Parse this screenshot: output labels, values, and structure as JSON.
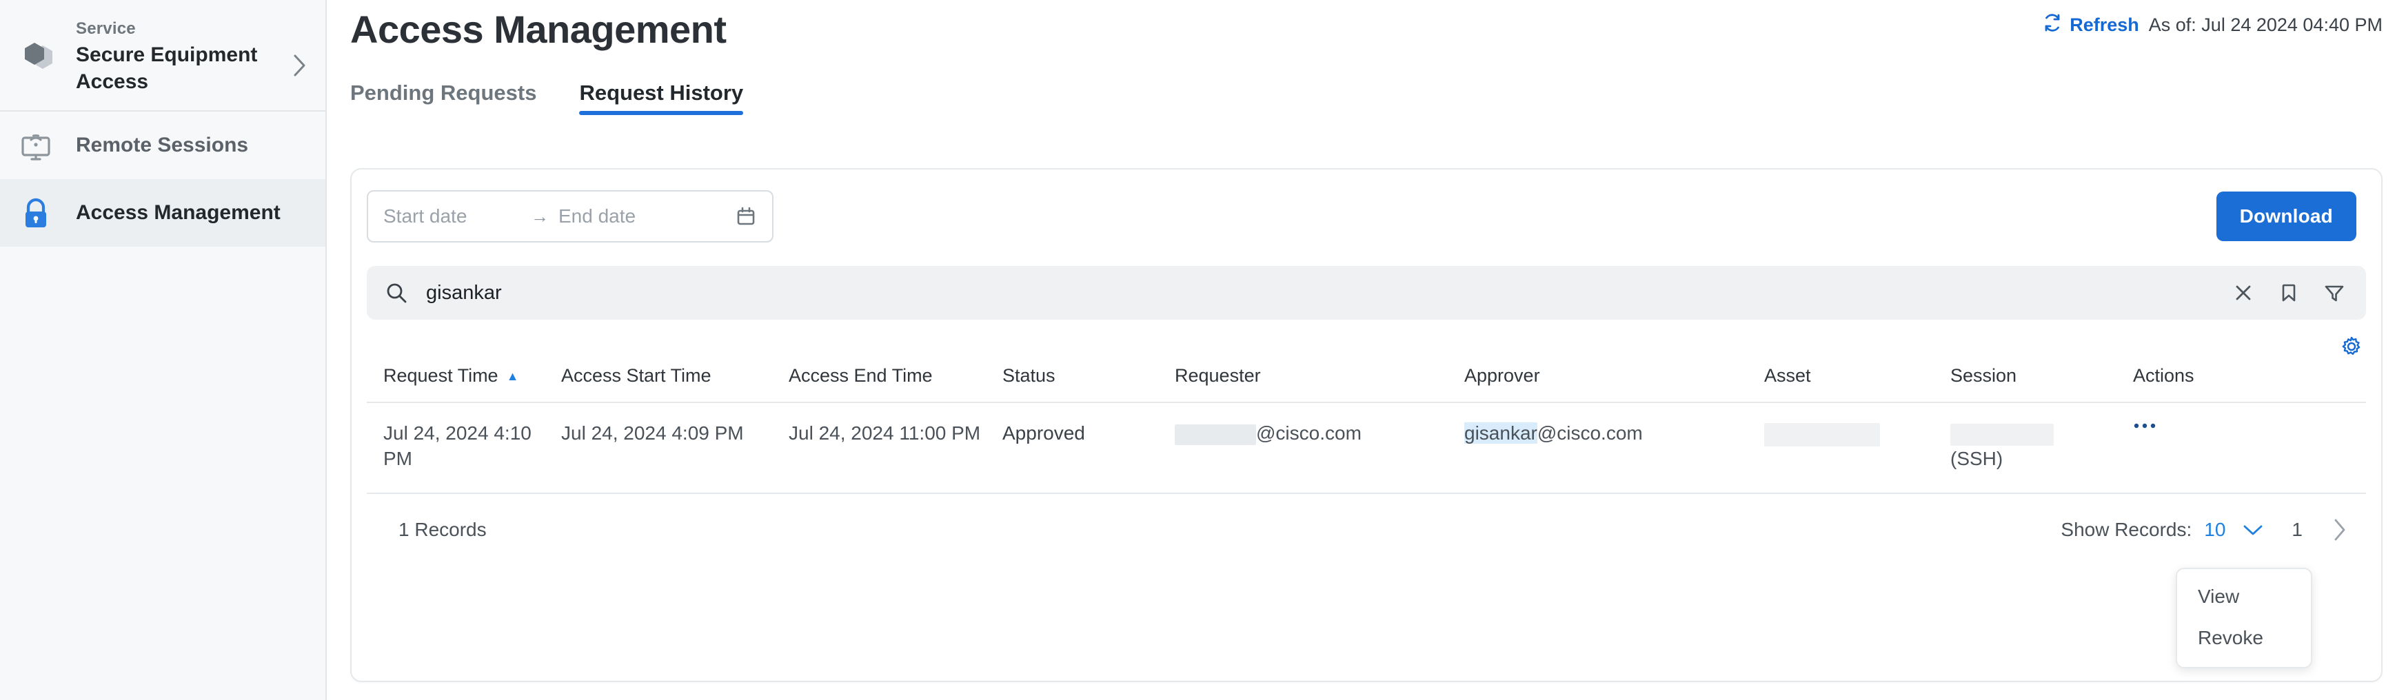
{
  "sidebar": {
    "service": {
      "eyebrow": "Service",
      "name": "Secure Equipment Access",
      "chevron_icon": "chevron-right-icon",
      "logo_icon": "hexagon-logo-icon"
    },
    "items": [
      {
        "label": "Remote Sessions",
        "icon": "remote-monitor-icon",
        "active": false
      },
      {
        "label": "Access Management",
        "icon": "lock-icon",
        "active": true
      }
    ]
  },
  "header": {
    "title": "Access Management",
    "refresh_label": "Refresh",
    "refresh_icon": "refresh-icon",
    "as_of": "As of: Jul 24 2024 04:40 PM"
  },
  "tabs": [
    {
      "label": "Pending Requests",
      "active": false
    },
    {
      "label": "Request History",
      "active": true
    }
  ],
  "filters": {
    "start_date_placeholder": "Start date",
    "range_arrow": "→",
    "end_date_placeholder": "End date",
    "calendar_icon": "calendar-icon",
    "download_label": "Download"
  },
  "search": {
    "icon": "search-icon",
    "value": "gisankar",
    "clear_icon": "close-icon",
    "bookmark_icon": "bookmark-icon",
    "filter_icon": "filter-icon"
  },
  "table": {
    "settings_icon": "gear-icon",
    "columns": [
      {
        "label": "Request Time",
        "sorted": true,
        "sort_icon": "▲"
      },
      {
        "label": "Access Start Time",
        "sorted": false
      },
      {
        "label": "Access End Time",
        "sorted": false
      },
      {
        "label": "Status",
        "sorted": false
      },
      {
        "label": "Requester",
        "sorted": false
      },
      {
        "label": "Approver",
        "sorted": false
      },
      {
        "label": "Asset",
        "sorted": false
      },
      {
        "label": "Session",
        "sorted": false
      },
      {
        "label": "Actions",
        "sorted": false
      }
    ],
    "rows": [
      {
        "request_time": "Jul 24, 2024 4:10 PM",
        "access_start_time": "Jul 24, 2024 4:09 PM",
        "access_end_time": "Jul 24, 2024 11:00 PM",
        "status": "Approved",
        "requester_suffix": "@cisco.com",
        "approver_match": "gisankar",
        "approver_suffix": "@cisco.com",
        "asset": "",
        "session_suffix": "(SSH)",
        "actions_icon": "kebab-menu-icon"
      }
    ],
    "footer": {
      "records": "1 Records",
      "show_records_label": "Show Records:",
      "show_records_value": "10",
      "show_records_chevron": "chevron-down-icon",
      "page_number": "1",
      "next_icon": "chevron-right-icon"
    }
  },
  "actions_menu": {
    "items": [
      {
        "label": "View"
      },
      {
        "label": "Revoke"
      }
    ]
  }
}
